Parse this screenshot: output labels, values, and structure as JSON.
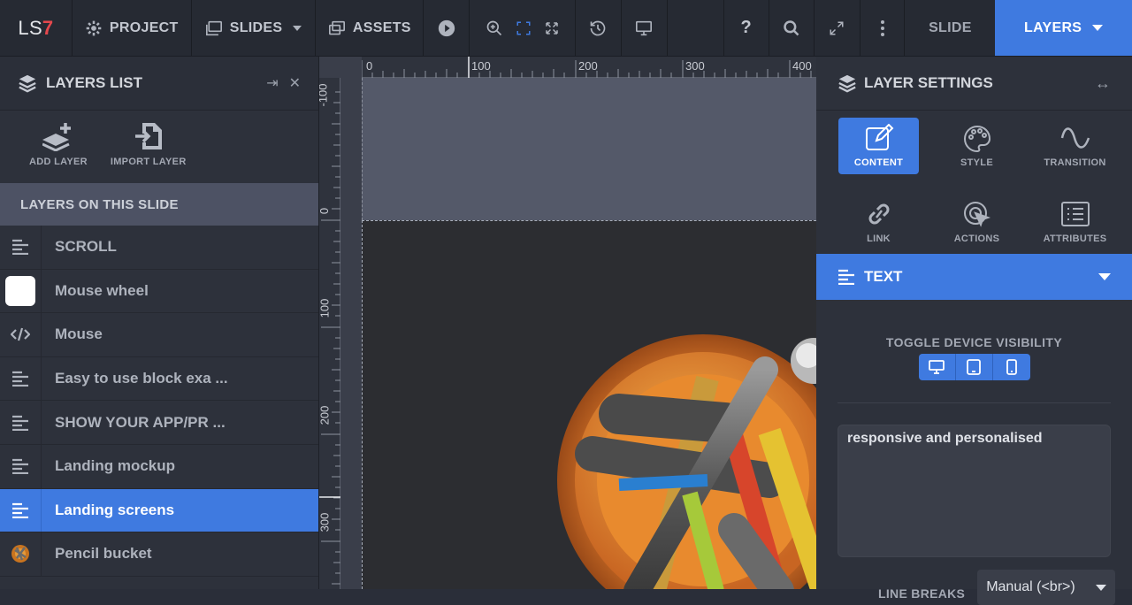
{
  "app": {
    "logo_text": "LS",
    "logo_num": "7"
  },
  "toolbar": {
    "project": "PROJECT",
    "slides": "SLIDES",
    "assets": "ASSETS",
    "slide_tab": "SLIDE",
    "layers_tab": "LAYERS",
    "help": "?"
  },
  "layers_panel": {
    "title": "LAYERS LIST",
    "add_layer": "ADD LAYER",
    "import_layer": "IMPORT LAYER",
    "section": "LAYERS ON THIS SLIDE",
    "items": [
      {
        "name": "SCROLL",
        "type": "text"
      },
      {
        "name": "Mouse wheel",
        "type": "shape"
      },
      {
        "name": "Mouse",
        "type": "html"
      },
      {
        "name": "Easy to use block exa ...",
        "type": "text"
      },
      {
        "name": "SHOW YOUR APP/PR ...",
        "type": "text"
      },
      {
        "name": "Landing mockup",
        "type": "text"
      },
      {
        "name": "Landing screens",
        "type": "text",
        "active": true
      },
      {
        "name": "Pencil bucket",
        "type": "image"
      }
    ]
  },
  "rulers": {
    "top": [
      "0",
      "100",
      "200",
      "300",
      "400"
    ],
    "left": [
      "-100",
      "0",
      "100",
      "200",
      "300"
    ]
  },
  "settings_panel": {
    "title": "LAYER SETTINGS",
    "tabs": {
      "content": "CONTENT",
      "style": "STYLE",
      "transition": "TRANSITION",
      "link": "LINK",
      "actions": "ACTIONS",
      "attributes": "ATTRIBUTES"
    },
    "layer_type": "TEXT",
    "visibility_label": "TOGGLE DEVICE VISIBILITY",
    "text_value": "responsive and personalised",
    "line_breaks_label": "LINE BREAKS",
    "line_breaks_value": "Manual (<br>)"
  },
  "colors": {
    "accent": "#3f7ae0",
    "logo_accent": "#e5484d"
  }
}
